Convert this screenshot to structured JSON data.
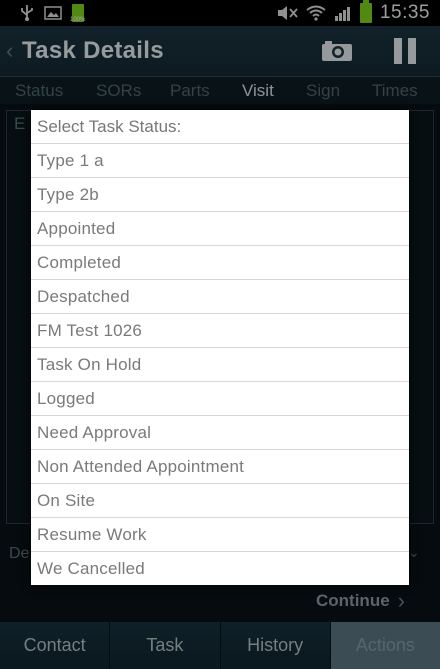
{
  "status_bar": {
    "time": "15:35",
    "battery_small_label": "100%",
    "icons": [
      "usb-icon",
      "image-icon",
      "battery-icon",
      "mute-icon",
      "wifi-icon",
      "signal-icon",
      "battery-icon"
    ]
  },
  "header": {
    "title": "Task Details",
    "icons": [
      "back-chevron-icon",
      "camera-icon",
      "pause-icon"
    ]
  },
  "tabs": [
    {
      "label": "Status"
    },
    {
      "label": "SORs"
    },
    {
      "label": "Parts"
    },
    {
      "label": "Visit"
    },
    {
      "label": "Sign"
    },
    {
      "label": "Times"
    }
  ],
  "background_peek": {
    "top_left": "E",
    "lower_left": "De"
  },
  "dialog": {
    "title": "Select Task Status:",
    "options": [
      "Type 1 a",
      "Type 2b",
      "Appointed",
      "Completed",
      "Despatched",
      "FM Test 1026",
      "Task On Hold",
      "Logged",
      "Need Approval",
      "Non Attended Appointment",
      "On Site",
      "Resume Work",
      "We Cancelled"
    ]
  },
  "continue": {
    "label": "Continue"
  },
  "bottom_nav": [
    {
      "label": "Contact"
    },
    {
      "label": "Task"
    },
    {
      "label": "History"
    },
    {
      "label": "Actions"
    }
  ],
  "colors": {
    "header_bg": "#1d3540",
    "active_nav": "#5c7681",
    "battery_green": "#7fd31c"
  }
}
